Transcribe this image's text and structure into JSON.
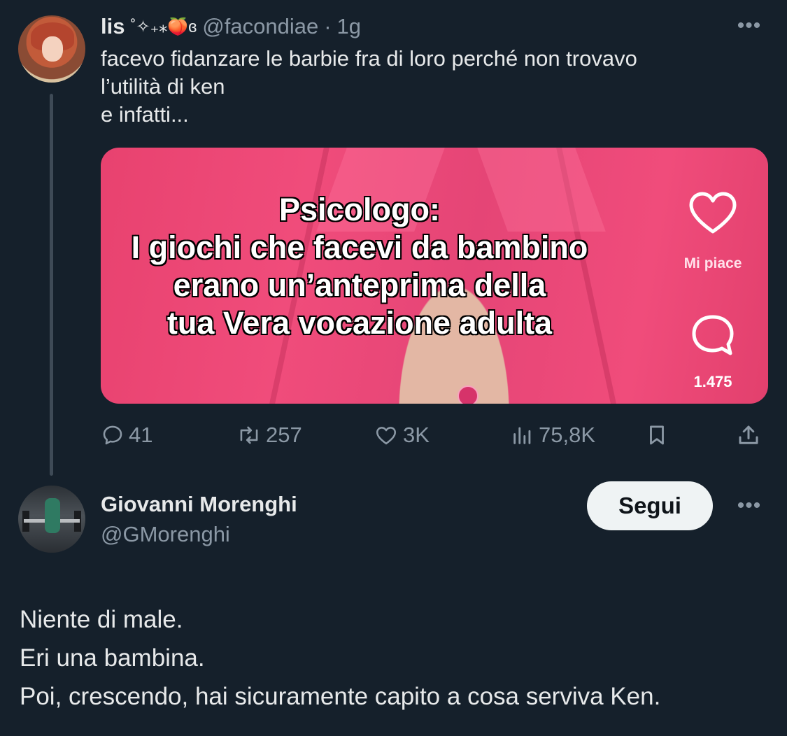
{
  "tweet": {
    "author_name": "lis",
    "author_decoration": "˚✧₊⁎🍑ɞ",
    "handle": "@facondiae",
    "separator": "·",
    "time": "1g",
    "more": "•••",
    "text": "facevo fidanzare le barbie fra di loro perché non trovavo\nl’utilità di ken\ne infatti...",
    "media": {
      "caption_lines": [
        "Psicologo:",
        "I giochi che facevi da bambino",
        "erano un’anteprima della",
        "tua Vera vocazione adulta"
      ],
      "like_label": "Mi piace",
      "comment_count": "1.475"
    },
    "actions": {
      "replies": "41",
      "reposts": "257",
      "likes": "3K",
      "views": "75,8K"
    }
  },
  "reply": {
    "author_name": "Giovanni Morenghi",
    "handle": "@GMorenghi",
    "follow_label": "Segui",
    "more": "•••",
    "lines": [
      "Niente di male.",
      "Eri una bambina.",
      "Poi, crescendo, hai sicuramente capito a cosa serviva Ken."
    ]
  },
  "colors": {
    "background": "#15202b",
    "text_primary": "#e7e9ea",
    "text_secondary": "#8b98a5",
    "media_pink": "#f04c7b",
    "follow_button_bg": "#eff3f4"
  },
  "icons": [
    "reply-icon",
    "repost-icon",
    "like-icon",
    "views-icon",
    "bookmark-icon",
    "share-icon",
    "tiktok-heart-icon",
    "tiktok-comment-icon"
  ]
}
